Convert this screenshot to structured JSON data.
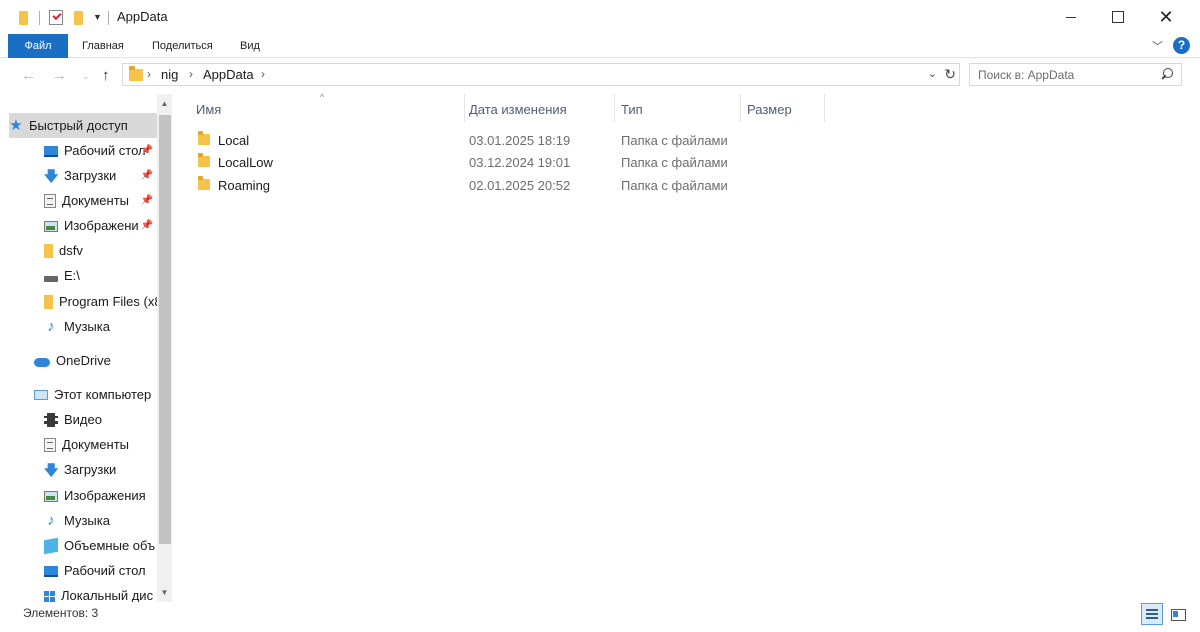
{
  "window": {
    "title": "AppData",
    "controls": {
      "minimize": "minimize",
      "maximize": "maximize",
      "close": "✕"
    }
  },
  "ribbon": {
    "tabs": [
      "Файл",
      "Главная",
      "Поделиться",
      "Вид"
    ],
    "help": "?"
  },
  "nav": {
    "breadcrumb": [
      "nig",
      "AppData"
    ],
    "search_placeholder": "Поиск в: AppData"
  },
  "sidebar": {
    "quick_access": "Быстрый доступ",
    "quick_items": [
      {
        "label": "Рабочий стол",
        "icon": "desktop-icon",
        "pinned": true
      },
      {
        "label": "Загрузки",
        "icon": "download-icon",
        "pinned": true
      },
      {
        "label": "Документы",
        "icon": "document-icon",
        "pinned": true
      },
      {
        "label": "Изображени",
        "icon": "image-icon",
        "pinned": true
      },
      {
        "label": "dsfv",
        "icon": "folder-icon",
        "pinned": false
      },
      {
        "label": "E:\\",
        "icon": "drive-icon",
        "pinned": false
      },
      {
        "label": "Program Files (x8",
        "icon": "folder-icon",
        "pinned": false
      },
      {
        "label": "Музыка",
        "icon": "music-icon",
        "pinned": false
      }
    ],
    "onedrive": "OneDrive",
    "this_pc": "Этот компьютер",
    "pc_items": [
      {
        "label": "Видео",
        "icon": "video-icon"
      },
      {
        "label": "Документы",
        "icon": "document-icon"
      },
      {
        "label": "Загрузки",
        "icon": "download-icon"
      },
      {
        "label": "Изображения",
        "icon": "image-icon"
      },
      {
        "label": "Музыка",
        "icon": "music-icon"
      },
      {
        "label": "Объемные объ",
        "icon": "3d-objects-icon"
      },
      {
        "label": "Рабочий стол",
        "icon": "desktop-icon"
      },
      {
        "label": "Локальный дис",
        "icon": "windows-drive-icon"
      }
    ]
  },
  "columns": [
    "Имя",
    "Дата изменения",
    "Тип",
    "Размер"
  ],
  "files": [
    {
      "name": "Local",
      "date": "03.01.2025 18:19",
      "type": "Папка с файлами"
    },
    {
      "name": "LocalLow",
      "date": "03.12.2024 19:01",
      "type": "Папка с файлами"
    },
    {
      "name": "Roaming",
      "date": "02.01.2025 20:52",
      "type": "Папка с файлами"
    }
  ],
  "status": {
    "item_count": "Элементов: 3"
  },
  "colors": {
    "accent": "#1a6fc4",
    "selection": "#d9d9d9",
    "folder": "#f5c24a"
  }
}
